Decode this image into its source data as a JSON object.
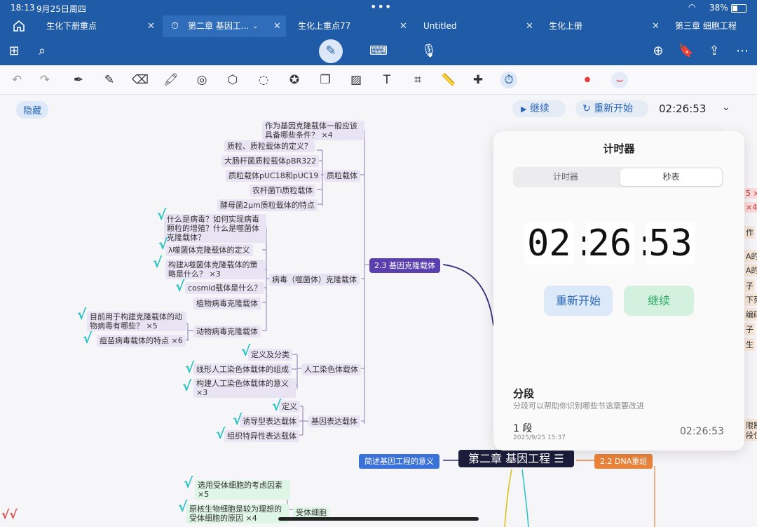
{
  "status": {
    "time": "18:13",
    "date": "9月25日周四",
    "battery": "38%"
  },
  "tabs": [
    {
      "label": "生化下册重点"
    },
    {
      "label": "第二章 基因工..."
    },
    {
      "label": "生化上重点77"
    },
    {
      "label": "Untitled"
    },
    {
      "label": "生化上册"
    },
    {
      "label": "第三章 细胞工程"
    }
  ],
  "canvas": {
    "hide_label": "隐藏"
  },
  "timer_bar": {
    "resume": "继续",
    "restart": "重新开始",
    "time": "02:26:53"
  },
  "panel": {
    "title": "计时器",
    "segments": [
      "计时器",
      "秒表"
    ],
    "hours": "02",
    "minutes": "26",
    "seconds": "53",
    "restart": "重新开始",
    "resume": "继续",
    "laps_title": "分段",
    "laps_desc": "分段可以帮助你识别哪些节选需要改进",
    "laps": [
      {
        "name": "1 段",
        "date": "2025/9/25 15:37",
        "time": "02:26:53"
      }
    ]
  },
  "mindmap": {
    "top_partial": "作为基因克隆载体一般应该具备哪些条件？ ×4",
    "plasmid_items": [
      "质粒、质粒载体的定义？",
      "大肠杆菌质粒载体pBR322",
      "质粒载体pUC18和pUC19",
      "农杆菌Ti质粒载体",
      "酵母菌2μm质粒载体的特点"
    ],
    "plasmid": "质粒载体",
    "virus_items": [
      "什么是病毒？如何实现病毒颗粒的增殖？什么是噬菌体克隆载体？",
      "λ噬菌体克隆载体的定义",
      "构建λ噬菌体克隆载体的策略是什么？ ×3",
      "cosmid载体是什么？",
      "植物病毒克隆载体"
    ],
    "animal_items": [
      "目前用于构建克隆载体的动物病毒有哪些？ ×5",
      "痘苗病毒载体的特点 ×6"
    ],
    "animal": "动物病毒克隆载体",
    "virus": "病毒（噬菌体）克隆载体",
    "artificial_items": [
      "定义及分类",
      "线形人工染色体载体的组成",
      "构建人工染色体载体的意义 ×3"
    ],
    "artificial": "人工染色体载体",
    "expr_items": [
      "定义",
      "诱导型表达载体",
      "组织特异性表达载体"
    ],
    "expr": "基因表达载体",
    "hub": "2.3 基因克隆载体",
    "root": "第二章 基因工程",
    "left_node": "简述基因工程的意义",
    "right_node": "2.2 DNA重组",
    "host_items": [
      "选用受体细胞的考虑因素 ×5",
      "原核生物细胞是较为理想的受体细胞的原因 ×4"
    ],
    "host": "受体细胞",
    "right_frags": [
      "5 ×",
      "×4",
      "作",
      "A的",
      "A的Ti",
      "子",
      "下列",
      "编码",
      "子",
      "生",
      "限制",
      "段位"
    ]
  },
  "colors": {
    "brand": "#1f5ba6",
    "hub": "#5a3fae",
    "root": "#1b1d3b",
    "check": "#2ec4c4"
  }
}
